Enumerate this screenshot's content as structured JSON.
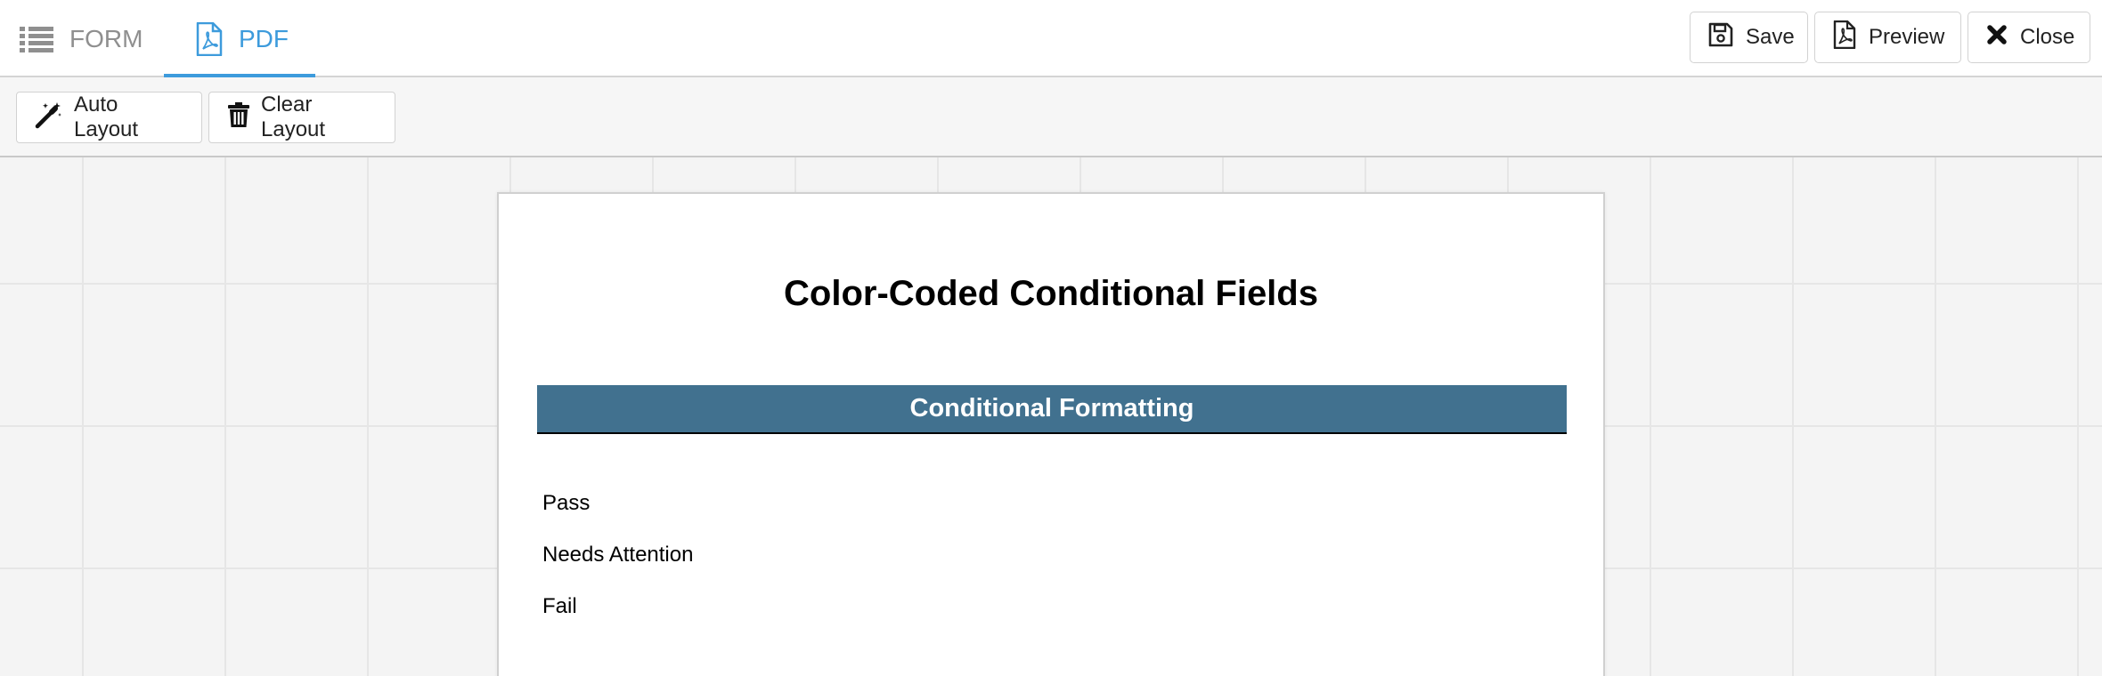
{
  "tabs": {
    "form_label": "FORM",
    "pdf_label": "PDF"
  },
  "actions": {
    "save_label": "Save",
    "preview_label": "Preview",
    "close_label": "Close"
  },
  "toolbar": {
    "auto_layout_label": "Auto Layout",
    "clear_layout_label": "Clear Layout"
  },
  "document": {
    "title": "Color-Coded Conditional Fields",
    "section_title": "Conditional Formatting",
    "items": [
      "Pass",
      "Needs Attention",
      "Fail"
    ]
  },
  "colors": {
    "accent": "#3d9bdc",
    "section_header_bg": "#41718f"
  },
  "icons": {
    "form_tab": "list-icon",
    "pdf_tab": "pdf-file-icon",
    "save": "floppy-disk-icon",
    "preview": "pdf-file-icon",
    "close": "close-icon",
    "auto_layout": "magic-wand-icon",
    "clear_layout": "trash-icon"
  }
}
